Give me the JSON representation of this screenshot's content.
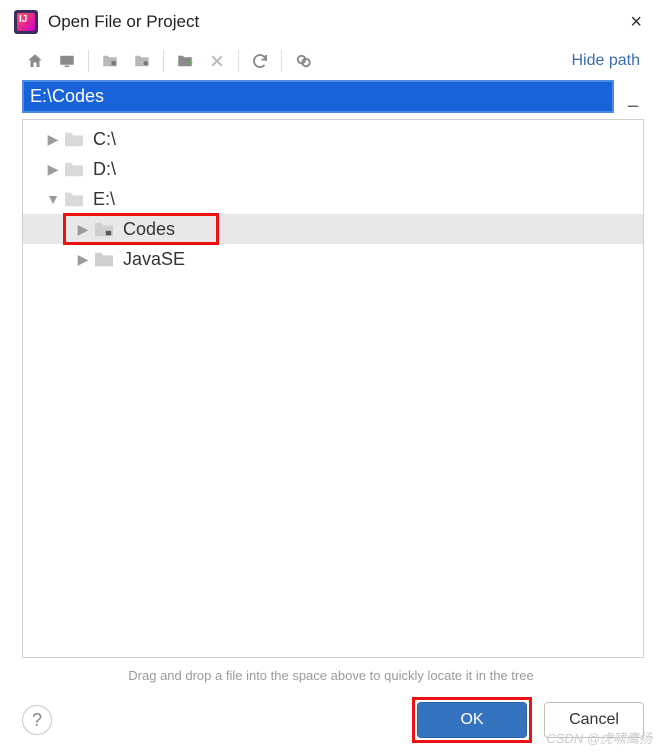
{
  "title": "Open File or Project",
  "close_label": "×",
  "toolbar": {
    "home": "home-icon",
    "desktop": "desktop-icon",
    "project": "project-icon",
    "module": "module-icon",
    "newfolder": "new-folder-icon",
    "delete": "delete-icon",
    "refresh": "refresh-icon",
    "showhidden": "show-hidden-icon",
    "hide_path": "Hide path"
  },
  "path": {
    "value": "E:\\Codes"
  },
  "tree": [
    {
      "label": "C:\\",
      "expanded": false,
      "depth": 1,
      "folderTint": "regular"
    },
    {
      "label": "D:\\",
      "expanded": false,
      "depth": 1,
      "folderTint": "regular"
    },
    {
      "label": "E:\\",
      "expanded": true,
      "depth": 1,
      "folderTint": "regular"
    },
    {
      "label": "Codes",
      "expanded": false,
      "depth": 2,
      "folderTint": "dark",
      "selected": true,
      "highlighted": true
    },
    {
      "label": "JavaSE",
      "expanded": false,
      "depth": 2,
      "folderTint": "regular"
    }
  ],
  "hint": "Drag and drop a file into the space above to quickly locate it in the tree",
  "buttons": {
    "ok": "OK",
    "cancel": "Cancel",
    "help": "?"
  },
  "watermark": "CSDN @虎啸鹰扬"
}
